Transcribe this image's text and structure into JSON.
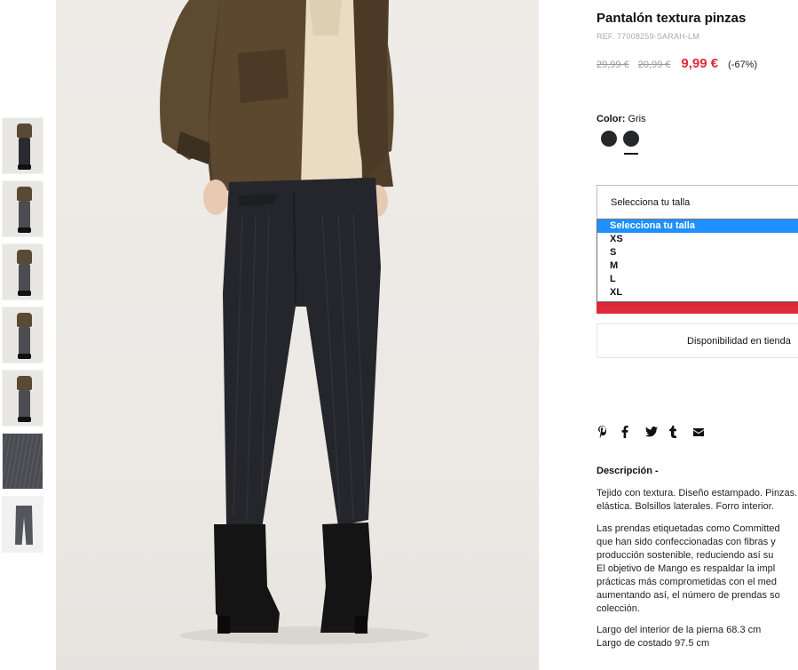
{
  "product": {
    "title": "Pantalón textura pinzas",
    "ref": "REF. 77008259-SARAH-LM",
    "price_original": "29,99 €",
    "price_previous": "20,99 €",
    "price_current": "9,99 €",
    "discount": "(-67%)",
    "color_label": "Color:",
    "color_value": "Gris",
    "swatch_color": "#26272a"
  },
  "size": {
    "select_label": "Selecciona tu talla",
    "options": [
      "Selecciona tu talla",
      "XS",
      "S",
      "M",
      "L",
      "XL"
    ]
  },
  "availability_label": "Disponibilidad en tienda",
  "share_icons": [
    "pinterest-icon",
    "facebook-icon",
    "twitter-icon",
    "tumblr-icon",
    "email-icon"
  ],
  "description": {
    "title": "Descripción -",
    "para1": [
      "Tejido con textura. Diseño estampado. Pinzas.",
      "elástica. Bolsillos laterales. Forro interior."
    ],
    "para2": [
      "Las prendas etiquetadas como Committed",
      "que han sido confeccionadas con fibras y",
      "producción sostenible, reduciendo así su",
      "El objetivo de Mango es respaldar la impl",
      "prácticas más comprometidas con el med",
      "aumentando así, el número de prendas so",
      "colección."
    ],
    "para3": [
      "Largo del interior de la pierna 68.3 cm",
      "Largo de costado 97.5 cm"
    ]
  },
  "colors": {
    "sale_red": "#e0293a",
    "selected_blue": "#1e90ff"
  }
}
